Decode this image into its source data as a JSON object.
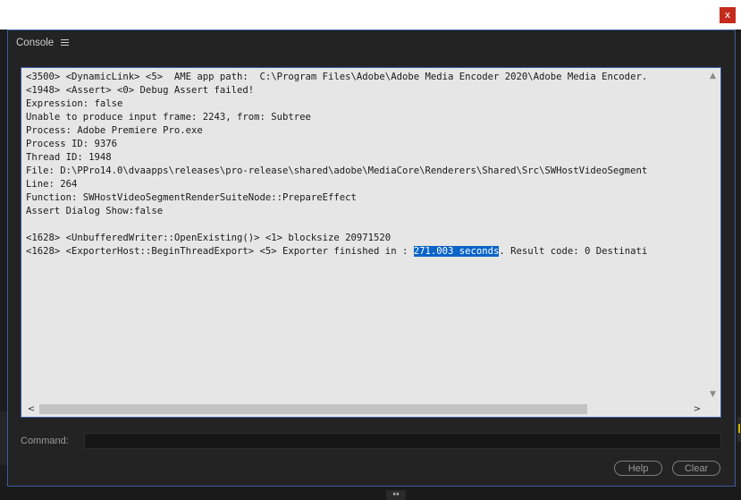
{
  "window": {
    "close_label": "x"
  },
  "panel": {
    "title": "Console",
    "menu_icon": "hamburger-menu-icon"
  },
  "output": {
    "lines": [
      "<3500> <DynamicLink> <5>  AME app path:  C:\\Program Files\\Adobe\\Adobe Media Encoder 2020\\Adobe Media Encoder.",
      "<1948> <Assert> <0> Debug Assert failed!",
      "Expression: false",
      "Unable to produce input frame: 2243, from: Subtree",
      "Process: Adobe Premiere Pro.exe",
      "Process ID: 9376",
      "Thread ID: 1948",
      "File: D:\\PPro14.0\\dvaapps\\releases\\pro-release\\shared\\adobe\\MediaCore\\Renderers\\Shared\\Src\\SWHostVideoSegment",
      "Line: 264",
      "Function: SWHostVideoSegmentRenderSuiteNode::PrepareEffect",
      "Assert Dialog Show:false",
      "",
      "<1628> <UnbufferedWriter::OpenExisting()> <1> blocksize 20971520"
    ],
    "last_line": {
      "before": "<1628> <ExporterHost::BeginThreadExport> <5> Exporter finished in : ",
      "highlight": "271.003 seconds",
      "after": ". Result code: 0 Destinati"
    },
    "highlight_color": "#0a64c8"
  },
  "scrollbars": {
    "up_arrow": "▲",
    "down_arrow": "▼",
    "left_arrow": "<",
    "right_arrow": ">"
  },
  "command": {
    "label": "Command:",
    "value": ""
  },
  "buttons": {
    "help": "Help",
    "clear": "Clear"
  },
  "bottom": {
    "glyph": "↔"
  }
}
